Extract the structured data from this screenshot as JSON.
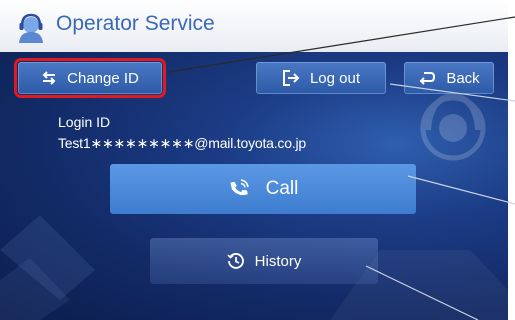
{
  "app": {
    "title": "Operator Service",
    "title_icon": "operator-headset-icon"
  },
  "toolbar": {
    "change_id_label": "Change ID",
    "change_id_icon": "swap-arrows-icon",
    "logout_label": "Log out",
    "logout_icon": "logout-arrow-icon",
    "back_label": "Back",
    "back_icon": "return-arrow-icon"
  },
  "account": {
    "login_label": "Login ID",
    "login_value": "Test1∗∗∗∗∗∗∗∗∗@mail.toyota.co.jp"
  },
  "actions": {
    "call_label": "Call",
    "call_icon": "phone-call-icon",
    "history_label": "History",
    "history_icon": "history-clock-icon"
  },
  "colors": {
    "highlight": "#e01a1f",
    "title_text": "#3a68b8",
    "call_button": "#4a8ad8"
  }
}
